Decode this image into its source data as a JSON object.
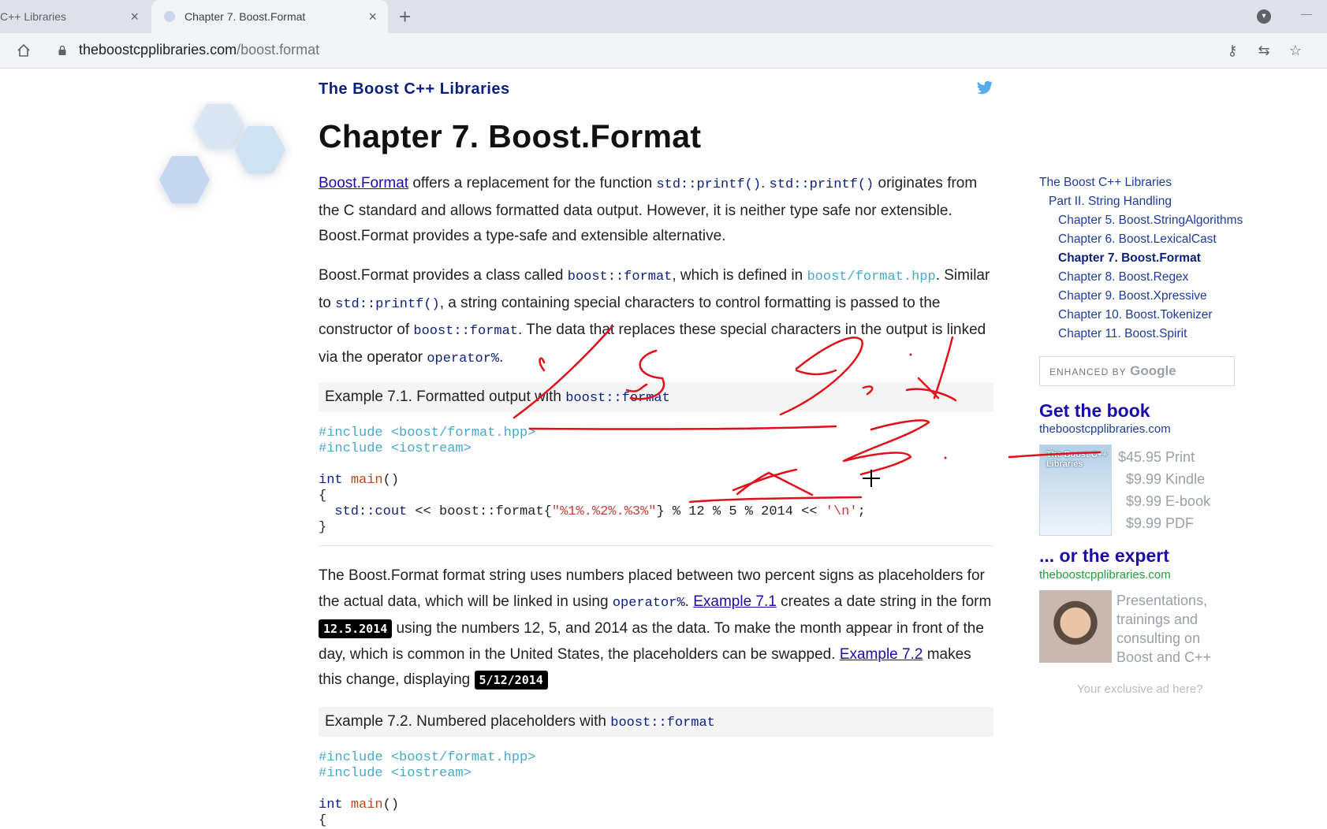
{
  "browser": {
    "tabs": [
      {
        "title": "C++ Libraries",
        "active": false
      },
      {
        "title": "Chapter 7. Boost.Format",
        "active": true
      }
    ],
    "url_host": "theboostcpplibraries.com",
    "url_path": "/boost.format"
  },
  "header": {
    "site_title": "The Boost C++ Libraries",
    "chapter_title": "Chapter 7. Boost.Format"
  },
  "intro": {
    "link": "Boost.Format",
    "t1": " offers a replacement for the function ",
    "c1": "std::printf()",
    "t2": ". ",
    "c2": "std::printf()",
    "t3": " originates from the C standard and allows formatted data output. However, it is neither type safe nor extensible. Boost.Format provides a type-safe and extensible alternative."
  },
  "para2": {
    "t1": "Boost.Format provides a class called ",
    "c1": "boost::format",
    "t2": ", which is defined in ",
    "c2": "boost/format.hpp",
    "t3": ". Similar to ",
    "c3": "std::printf()",
    "t4": ", a string containing special characters to control formatting is passed to the constructor of ",
    "c4": "boost::format",
    "t5": ". The data that replaces these special characters in the output is linked via the operator ",
    "c5": "operator%",
    "t6": "."
  },
  "example1": {
    "title": "Example 7.1. Formatted output with ",
    "title_code": "boost::format",
    "inc1": "#include <boost/format.hpp>",
    "inc2": "#include <iostream>",
    "kw_int": "int",
    "fn_main": "main",
    "parens": "()",
    "brace_open": "{",
    "l_ns": "std::cout",
    "l_mid": " << boost::format{",
    "l_str": "\"%1%.%2%.%3%\"",
    "l_rest": "} % 12 % 5 % 2014 << ",
    "l_nl": "'\\n'",
    "l_end": ";",
    "brace_close": "}"
  },
  "para3": {
    "t1": "The Boost.Format format string uses numbers placed between two percent signs as placeholders for the actual data, which will be linked in using ",
    "c1": "operator%",
    "t2": ". ",
    "link1": "Example 7.1",
    "t3": " creates a date string in the form ",
    "badge1": "12.5.2014",
    "t4": " using the numbers 12, 5, and 2014 as the data. To make the month appear in front of the day, which is common in the United States, the placeholders can be swapped. ",
    "link2": "Example 7.2",
    "t5": " makes this change, displaying ",
    "badge2": "5/12/2014"
  },
  "example2": {
    "title": "Example 7.2. Numbered placeholders with ",
    "title_code": "boost::format",
    "inc1": "#include <boost/format.hpp>",
    "inc2": "#include <iostream>",
    "kw_int": "int",
    "fn_main": "main",
    "parens": "()",
    "brace_open": "{"
  },
  "sidebar": {
    "toc": [
      {
        "label": "The Boost C++ Libraries",
        "level": 1
      },
      {
        "label": "Part II. String Handling",
        "level": 2
      },
      {
        "label": "Chapter 5. Boost.StringAlgorithms",
        "level": 3
      },
      {
        "label": "Chapter 6. Boost.LexicalCast",
        "level": 3
      },
      {
        "label": "Chapter 7. Boost.Format",
        "level": 3,
        "current": true
      },
      {
        "label": "Chapter 8. Boost.Regex",
        "level": 3
      },
      {
        "label": "Chapter 9. Boost.Xpressive",
        "level": 3
      },
      {
        "label": "Chapter 10. Boost.Tokenizer",
        "level": 3
      },
      {
        "label": "Chapter 11. Boost.Spirit",
        "level": 3
      }
    ],
    "search_enhanced": "ENHANCED BY",
    "search_google": "Google",
    "book_title": "Get the book",
    "book_site": "theboostcpplibraries.com",
    "book_cover_text": "The Boost C++ Libraries",
    "prices": [
      "$45.95 Print",
      "$9.99 Kindle",
      "$9.99 E-book",
      "$9.99 PDF"
    ],
    "expert_title": "... or the expert",
    "expert_site": "theboostcpplibraries.com",
    "expert_text": "Presentations, trainings and consulting on Boost and C++",
    "ad_text": "Your exclusive ad here?"
  },
  "colors": {
    "annotation_ink": "#e0101a",
    "link": "#1a0dab",
    "code_keyword": "#0b1f7d",
    "include": "#4aa8c8",
    "expert_site": "#1e9e3a"
  }
}
